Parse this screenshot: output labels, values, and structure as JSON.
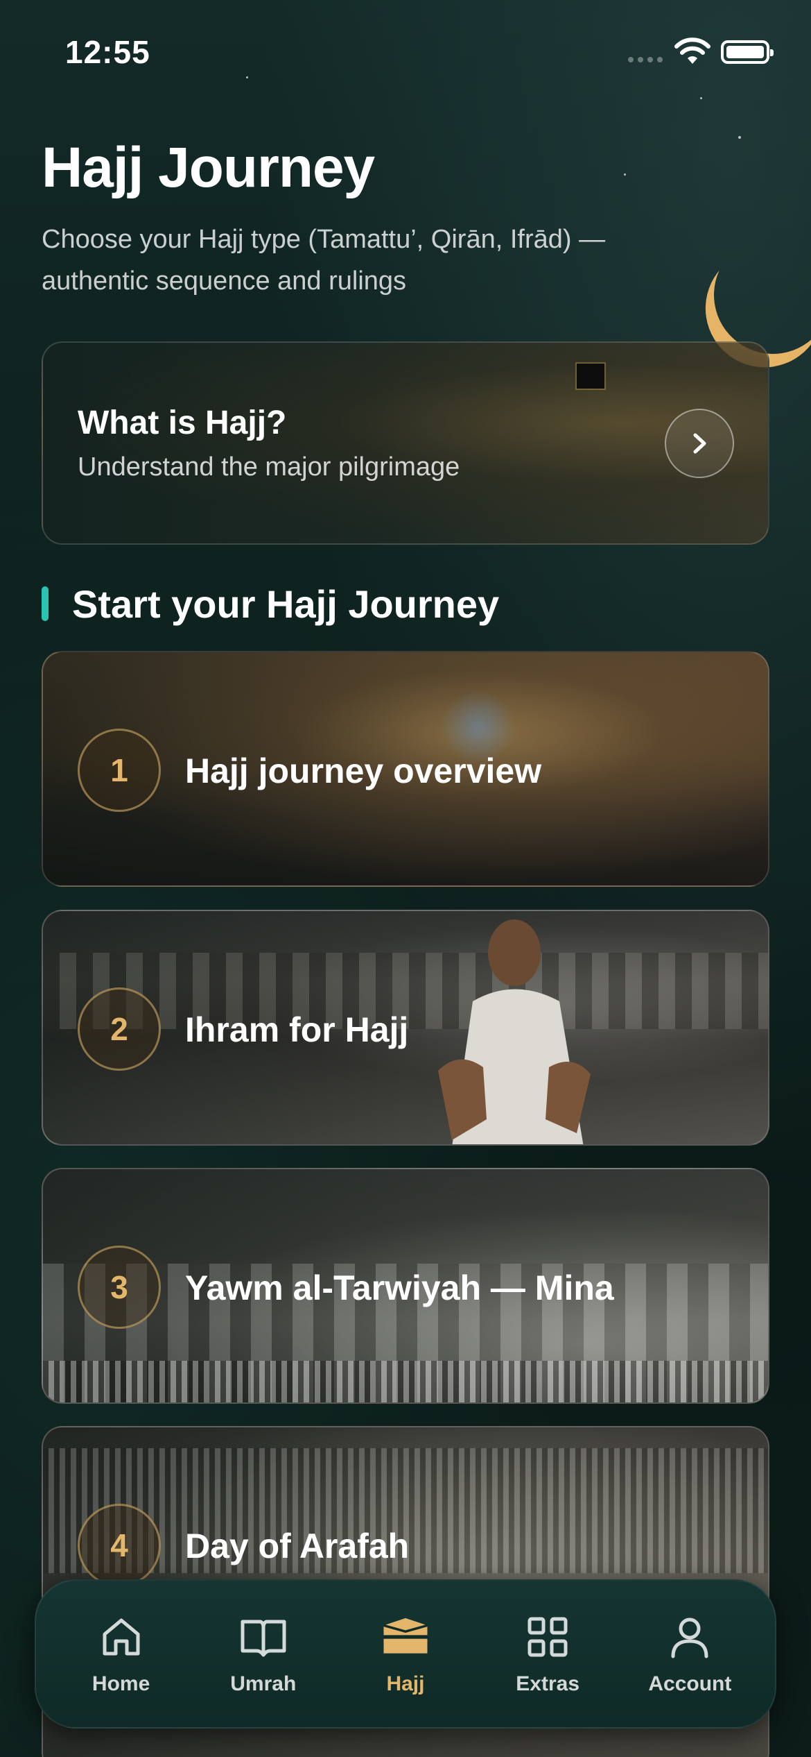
{
  "status_bar": {
    "time": "12:55"
  },
  "header": {
    "title": "Hajj Journey",
    "subtitle": "Choose your Hajj type (Tamattu’, Qirān, Ifrād) — authentic sequence and rulings"
  },
  "intro_card": {
    "title": "What is Hajj?",
    "subtitle": "Understand the major pilgrimage"
  },
  "section": {
    "title": "Start your Hajj Journey"
  },
  "steps": [
    {
      "number": "1",
      "label": "Hajj journey overview"
    },
    {
      "number": "2",
      "label": "Ihram for Hajj"
    },
    {
      "number": "3",
      "label": "Yawm al-Tarwiyah — Mina"
    },
    {
      "number": "4",
      "label": "Day of Arafah"
    }
  ],
  "tab_bar": {
    "accent": "#e3b66c",
    "items": [
      {
        "label": "Home",
        "icon": "home-icon"
      },
      {
        "label": "Umrah",
        "icon": "book-icon"
      },
      {
        "label": "Hajj",
        "icon": "kaaba-icon",
        "active": true
      },
      {
        "label": "Extras",
        "icon": "grid-icon"
      },
      {
        "label": "Account",
        "icon": "user-icon"
      }
    ]
  }
}
